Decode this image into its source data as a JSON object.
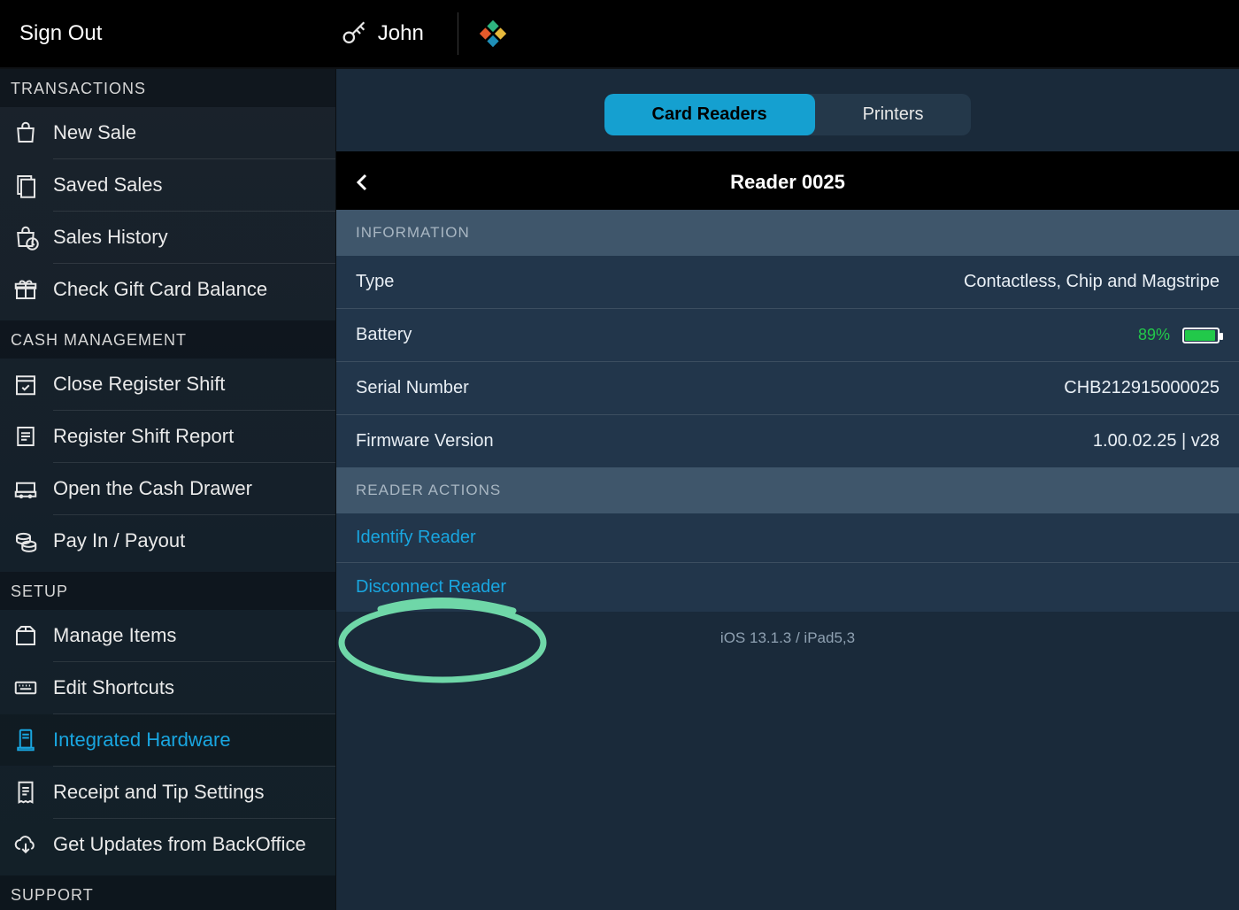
{
  "top": {
    "signout": "Sign Out",
    "user": "John"
  },
  "sidebar": {
    "sections": [
      {
        "header": "TRANSACTIONS",
        "items": [
          {
            "label": "New Sale",
            "icon": "bag-icon"
          },
          {
            "label": "Saved Sales",
            "icon": "saved-icon"
          },
          {
            "label": "Sales History",
            "icon": "bag-clock-icon"
          },
          {
            "label": "Check Gift Card Balance",
            "icon": "gift-icon"
          }
        ]
      },
      {
        "header": "CASH MANAGEMENT",
        "items": [
          {
            "label": "Close Register Shift",
            "icon": "calendar-check-icon"
          },
          {
            "label": "Register Shift Report",
            "icon": "report-icon"
          },
          {
            "label": "Open the Cash Drawer",
            "icon": "drawer-icon"
          },
          {
            "label": "Pay In / Payout",
            "icon": "coins-icon"
          }
        ]
      },
      {
        "header": "SETUP",
        "items": [
          {
            "label": "Manage Items",
            "icon": "box-icon"
          },
          {
            "label": "Edit Shortcuts",
            "icon": "keyboard-icon"
          },
          {
            "label": "Integrated Hardware",
            "icon": "hardware-icon",
            "active": true
          },
          {
            "label": "Receipt and Tip Settings",
            "icon": "receipt-icon"
          },
          {
            "label": "Get Updates from BackOffice",
            "icon": "cloud-download-icon"
          }
        ]
      },
      {
        "header": "SUPPORT",
        "items": []
      }
    ]
  },
  "main": {
    "tabs": {
      "card_readers": "Card Readers",
      "printers": "Printers",
      "selected": "card_readers"
    },
    "subtitle": "Reader 0025",
    "info_header": "INFORMATION",
    "info": {
      "type_label": "Type",
      "type_value": "Contactless, Chip and Magstripe",
      "battery_label": "Battery",
      "battery_pct": "89%",
      "battery_level": 89,
      "serial_label": "Serial Number",
      "serial_value": "CHB212915000025",
      "fw_label": "Firmware Version",
      "fw_value": "1.00.02.25 | v28"
    },
    "actions_header": "READER ACTIONS",
    "actions": {
      "identify": "Identify Reader",
      "disconnect": "Disconnect Reader"
    },
    "footer": "iOS 13.1.3 / iPad5,3"
  }
}
